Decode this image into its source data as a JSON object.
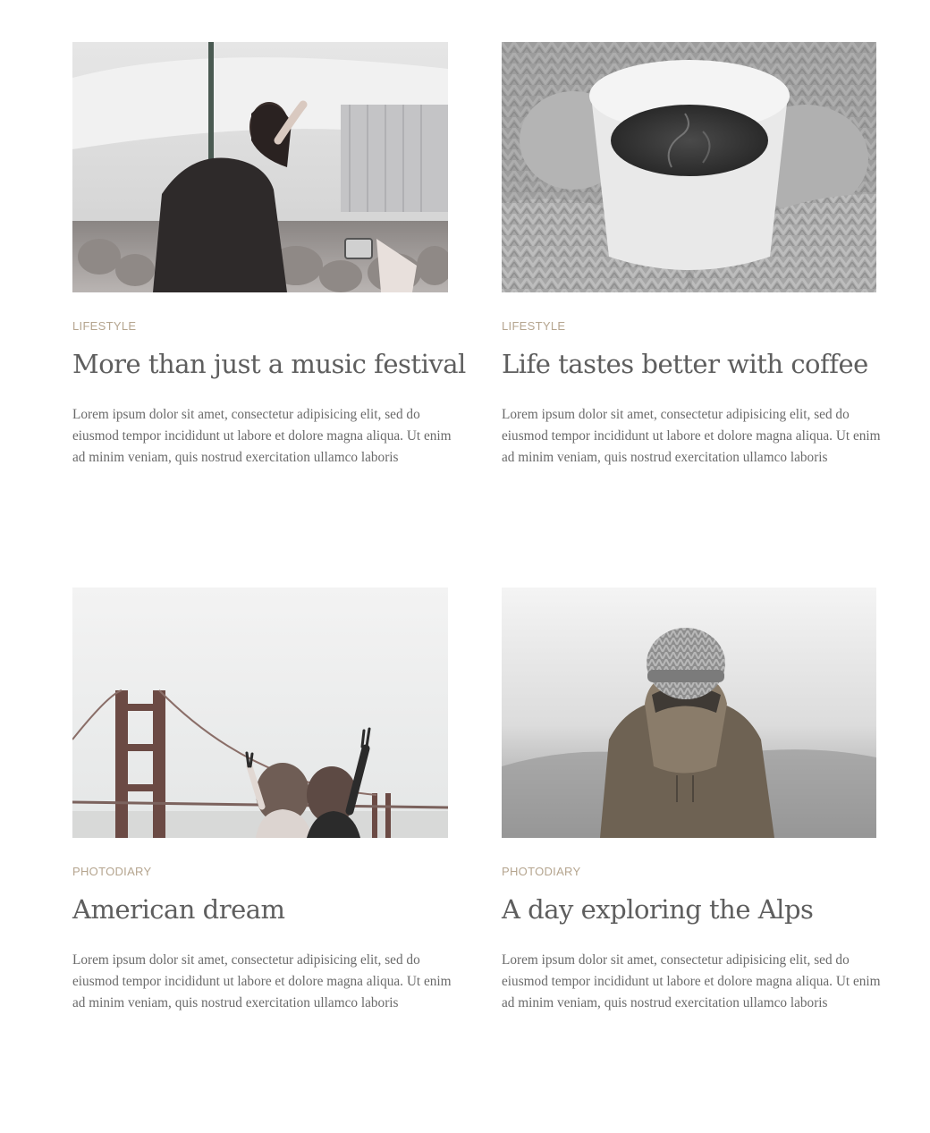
{
  "posts": [
    {
      "category": "LIFESTYLE",
      "title": "More than just a music festival",
      "excerpt": "Lorem ipsum dolor sit amet, consectetur adipisicing elit, sed do eiusmod tempor incididunt ut labore et dolore magna aliqua. Ut enim ad minim veniam, quis nostrud exercitation ullamco laboris"
    },
    {
      "category": "LIFESTYLE",
      "title": "Life tastes better with coffee",
      "excerpt": "Lorem ipsum dolor sit amet, consectetur adipisicing elit, sed do eiusmod tempor incididunt ut labore et dolore magna aliqua. Ut enim ad minim veniam, quis nostrud exercitation ullamco laboris"
    },
    {
      "category": "PHOTODIARY",
      "title": "American dream",
      "excerpt": "Lorem ipsum dolor sit amet, consectetur adipisicing elit, sed do eiusmod tempor incididunt ut labore et dolore magna aliqua. Ut enim ad minim veniam, quis nostrud exercitation ullamco laboris"
    },
    {
      "category": "PHOTODIARY",
      "title": "A day exploring the Alps",
      "excerpt": "Lorem ipsum dolor sit amet, consectetur adipisicing elit, sed do eiusmod tempor incididunt ut labore et dolore magna aliqua. Ut enim ad minim veniam, quis nostrud exercitation ullamco laboris"
    }
  ],
  "colors": {
    "category": "#b5a58f",
    "title": "#5e5e5e",
    "text": "#6a6a6a",
    "background": "#ffffff"
  }
}
